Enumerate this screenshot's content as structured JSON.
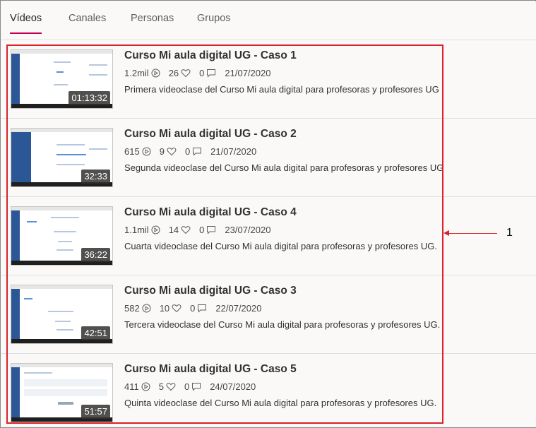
{
  "tabs": [
    {
      "label": "Vídeos",
      "active": true
    },
    {
      "label": "Canales",
      "active": false
    },
    {
      "label": "Personas",
      "active": false
    },
    {
      "label": "Grupos",
      "active": false
    }
  ],
  "videos": [
    {
      "title": "Curso Mi aula digital UG - Caso 1",
      "views": "1.2mil",
      "likes": "26",
      "comments": "0",
      "date": "21/07/2020",
      "description": "Primera videoclase del Curso Mi aula digital para profesoras y profesores UG",
      "duration": "01:13:32"
    },
    {
      "title": "Curso Mi aula digital UG - Caso 2",
      "views": "615",
      "likes": "9",
      "comments": "0",
      "date": "21/07/2020",
      "description": "Segunda videoclase del Curso Mi aula digital para profesoras y profesores UG",
      "duration": "32:33"
    },
    {
      "title": "Curso Mi aula digital UG - Caso 4",
      "views": "1.1mil",
      "likes": "14",
      "comments": "0",
      "date": "23/07/2020",
      "description": "Cuarta videoclase del Curso Mi aula digital para profesoras y profesores UG.",
      "duration": "36:22"
    },
    {
      "title": "Curso Mi aula digital UG - Caso 3",
      "views": "582",
      "likes": "10",
      "comments": "0",
      "date": "22/07/2020",
      "description": "Tercera videoclase del Curso Mi aula digital para profesoras y profesores UG.",
      "duration": "42:51"
    },
    {
      "title": "Curso Mi aula digital UG - Caso 5",
      "views": "411",
      "likes": "5",
      "comments": "0",
      "date": "24/07/2020",
      "description": "Quinta videoclase del Curso Mi aula digital para profesoras y profesores UG.",
      "duration": "51:57"
    }
  ],
  "callout": {
    "number": "1"
  },
  "colors": {
    "accent": "#c30052",
    "annotation": "#d9222a"
  }
}
